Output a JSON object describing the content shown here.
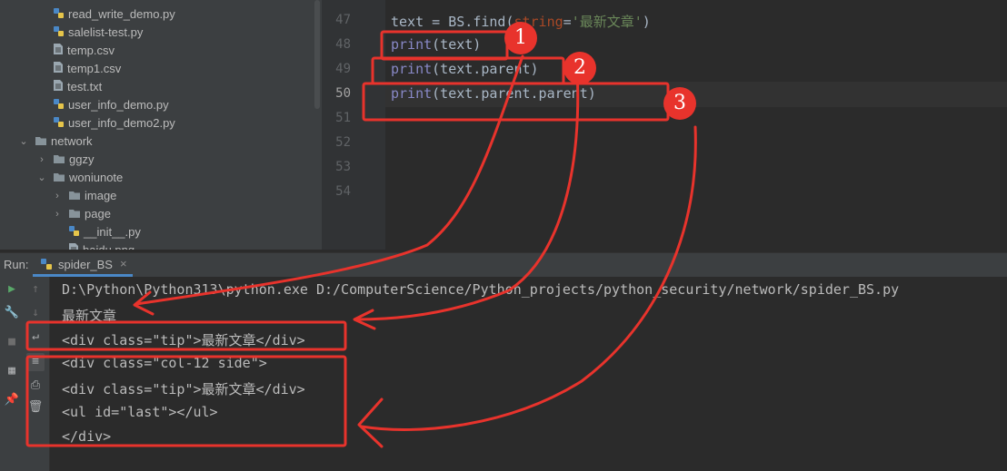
{
  "project_tree": [
    {
      "label": "read_write_demo.py",
      "kind": "py",
      "indent": 1
    },
    {
      "label": "salelist-test.py",
      "kind": "py",
      "indent": 1
    },
    {
      "label": "temp.csv",
      "kind": "file",
      "indent": 1
    },
    {
      "label": "temp1.csv",
      "kind": "file",
      "indent": 1
    },
    {
      "label": "test.txt",
      "kind": "file",
      "indent": 1
    },
    {
      "label": "user_info_demo.py",
      "kind": "py",
      "indent": 1
    },
    {
      "label": "user_info_demo2.py",
      "kind": "py",
      "indent": 1
    },
    {
      "label": "network",
      "kind": "folder-open",
      "indent": 0
    },
    {
      "label": "ggzy",
      "kind": "folder",
      "indent": 1
    },
    {
      "label": "woniunote",
      "kind": "folder-open",
      "indent": 1
    },
    {
      "label": "image",
      "kind": "folder",
      "indent": 2
    },
    {
      "label": "page",
      "kind": "folder",
      "indent": 2
    },
    {
      "label": "__init__.py",
      "kind": "py",
      "indent": 2
    },
    {
      "label": "baidu.png",
      "kind": "file",
      "indent": 2
    }
  ],
  "editor": {
    "line_numbers": [
      "47",
      "48",
      "49",
      "50",
      "51",
      "52",
      "53",
      "54"
    ],
    "current_line": "50",
    "line47": {
      "a": "text = BS.",
      "fn": "find",
      "b": "(",
      "param": "string",
      "c": "=",
      "str": "'最新文章'",
      "d": ")"
    },
    "line48": {
      "fn": "print",
      "rest": "(text)"
    },
    "line49": {
      "fn": "print",
      "rest": "(text.parent)"
    },
    "line50": {
      "fn": "print",
      "rest": "(text.parent.parent)"
    }
  },
  "run_panel": {
    "label": "Run:",
    "tab": "spider_BS",
    "close": "×"
  },
  "console_lines": [
    "D:\\Python\\Python313\\python.exe D:/ComputerScience/Python_projects/python_security/network/spider_BS.py",
    "最新文章",
    "<div class=\"tip\">最新文章</div>",
    "<div class=\"col-12 side\">",
    "<div class=\"tip\">最新文章</div>",
    "<ul id=\"last\"></ul>",
    "</div>"
  ],
  "annotations": {
    "markers": [
      "1",
      "2",
      "3"
    ],
    "color": "#e8332c"
  },
  "colors": {
    "editor_bg": "#2b2b2b",
    "panel_bg": "#3c3f41",
    "builtin_fn": "#8888c6",
    "string": "#6a8759",
    "keyword_param": "#aa4926"
  }
}
